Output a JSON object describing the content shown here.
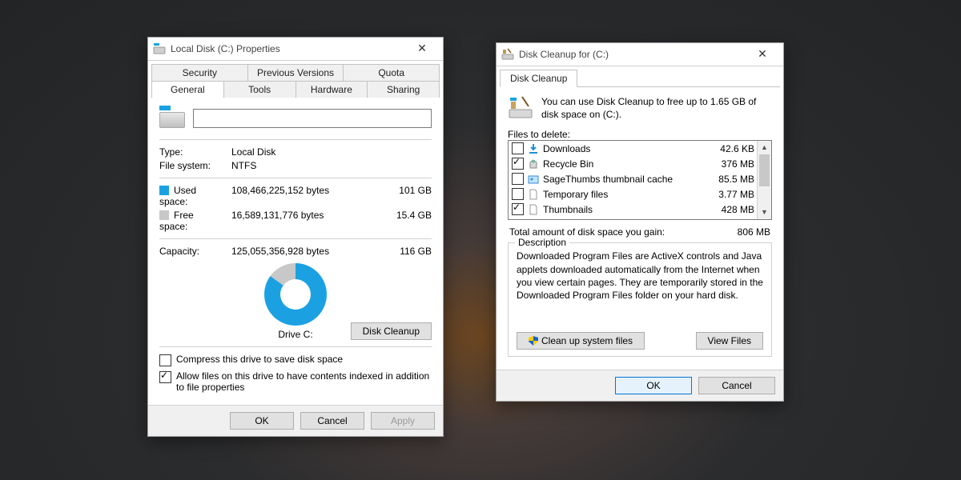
{
  "properties": {
    "title": "Local Disk (C:) Properties",
    "tabs_row1": [
      "Security",
      "Previous Versions",
      "Quota"
    ],
    "tabs_row2": [
      "General",
      "Tools",
      "Hardware",
      "Sharing"
    ],
    "active_tab": "General",
    "name_value": "",
    "type_label": "Type:",
    "type_value": "Local Disk",
    "fs_label": "File system:",
    "fs_value": "NTFS",
    "used_label": "Used space:",
    "used_bytes": "108,466,225,152 bytes",
    "used_human": "101 GB",
    "free_label": "Free space:",
    "free_bytes": "16,589,131,776 bytes",
    "free_human": "15.4 GB",
    "cap_label": "Capacity:",
    "cap_bytes": "125,055,356,928 bytes",
    "cap_human": "116 GB",
    "drive_label": "Drive C:",
    "disk_cleanup_btn": "Disk Cleanup",
    "compress_label": "Compress this drive to save disk space",
    "index_label": "Allow files on this drive to have contents indexed in addition to file properties",
    "ok": "OK",
    "cancel": "Cancel",
    "apply": "Apply"
  },
  "cleanup": {
    "title": "Disk Cleanup for  (C:)",
    "tab": "Disk Cleanup",
    "intro": "You can use Disk Cleanup to free up to 1.65 GB of disk space on  (C:).",
    "files_label": "Files to delete:",
    "items": [
      {
        "checked": false,
        "icon": "download",
        "name": "Downloads",
        "size": "42.6 KB"
      },
      {
        "checked": true,
        "icon": "recycle",
        "name": "Recycle Bin",
        "size": "376 MB"
      },
      {
        "checked": false,
        "icon": "thumb",
        "name": "SageThumbs thumbnail cache",
        "size": "85.5 MB"
      },
      {
        "checked": false,
        "icon": "file",
        "name": "Temporary files",
        "size": "3.77 MB"
      },
      {
        "checked": true,
        "icon": "file",
        "name": "Thumbnails",
        "size": "428 MB"
      }
    ],
    "total_label": "Total amount of disk space you gain:",
    "total_value": "806 MB",
    "desc_legend": "Description",
    "desc_text": "Downloaded Program Files are ActiveX controls and Java applets downloaded automatically from the Internet when you view certain pages. They are temporarily stored in the Downloaded Program Files folder on your hard disk.",
    "clean_sys_btn": "Clean up system files",
    "view_files_btn": "View Files",
    "ok": "OK",
    "cancel": "Cancel"
  }
}
